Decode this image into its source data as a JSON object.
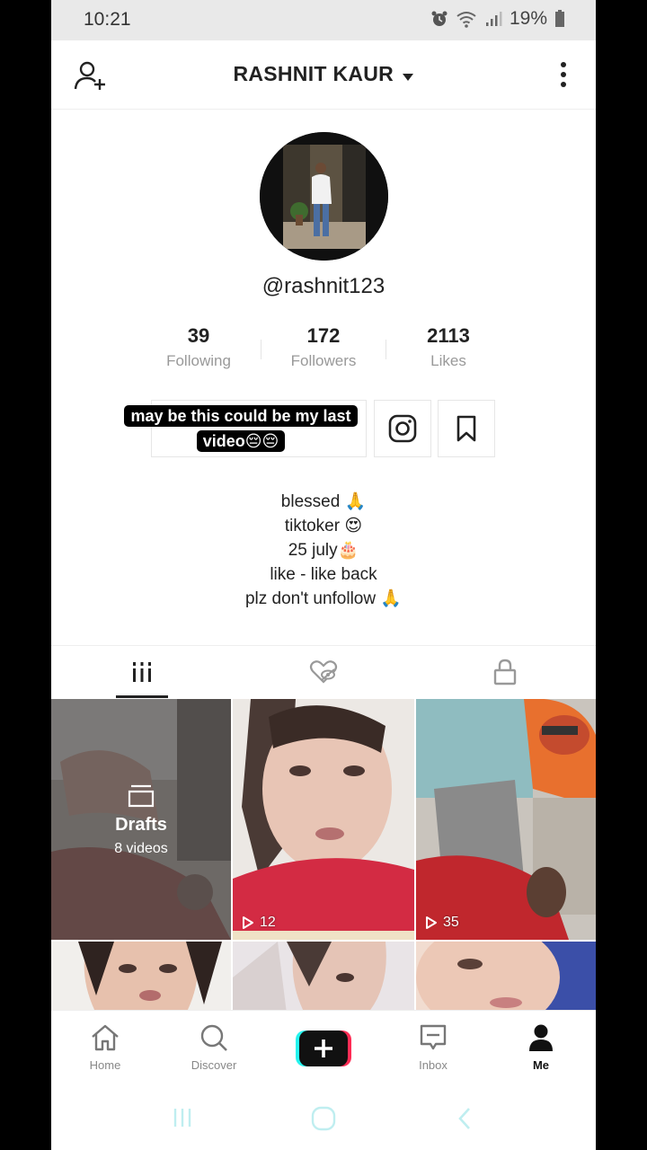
{
  "status": {
    "time": "10:21",
    "battery": "19%"
  },
  "header": {
    "name": "RASHNIT KAUR"
  },
  "profile": {
    "handle": "@rashnit123"
  },
  "stats": [
    {
      "value": "39",
      "label": "Following"
    },
    {
      "value": "172",
      "label": "Followers"
    },
    {
      "value": "2113",
      "label": "Likes"
    }
  ],
  "caption": "may be this could be my last video😔😔",
  "bio": [
    "blessed 🙏",
    "tiktoker 😍",
    "25 july🎂",
    "like - like back",
    "plz don't unfollow 🙏"
  ],
  "drafts": {
    "title": "Drafts",
    "count": "8 videos"
  },
  "videos": [
    {
      "plays": "12"
    },
    {
      "plays": "35"
    }
  ],
  "nav": {
    "home": "Home",
    "discover": "Discover",
    "inbox": "Inbox",
    "me": "Me"
  },
  "colors": {
    "accent_red": "#fe2c55",
    "accent_cyan": "#25f4ee"
  }
}
